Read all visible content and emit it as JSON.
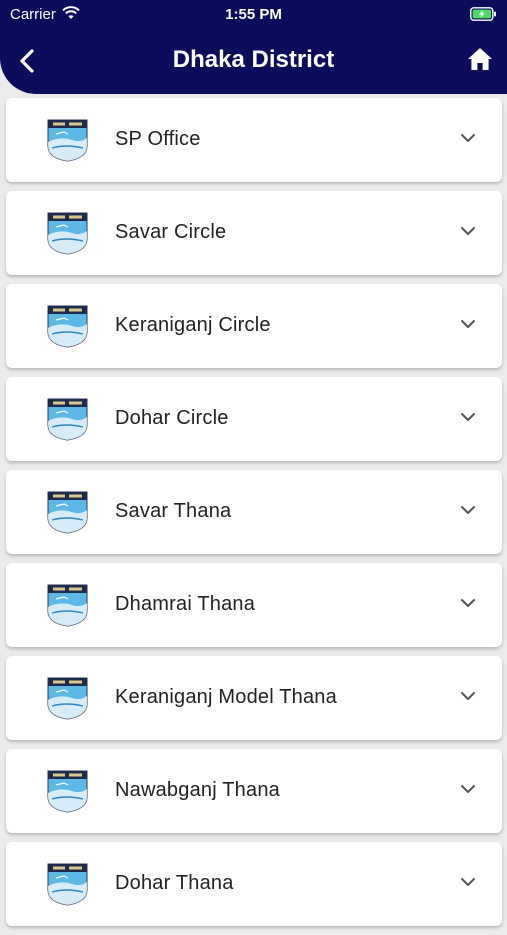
{
  "status_bar": {
    "carrier": "Carrier",
    "time": "1:55 PM",
    "icons": [
      "wifi-icon",
      "battery-charging-icon"
    ]
  },
  "header": {
    "title": "Dhaka District",
    "back_icon": "chevron-left-icon",
    "home_icon": "home-icon"
  },
  "colors": {
    "header_bg": "#0b0d5c",
    "page_bg": "#ebebeb",
    "card_bg": "#ffffff",
    "battery_fill": "#4cd964"
  },
  "list": {
    "items": [
      {
        "label": "SP Office"
      },
      {
        "label": "Savar Circle"
      },
      {
        "label": "Keraniganj Circle"
      },
      {
        "label": "Dohar Circle"
      },
      {
        "label": "Savar Thana"
      },
      {
        "label": "Dhamrai Thana"
      },
      {
        "label": "Keraniganj Model Thana"
      },
      {
        "label": "Nawabganj Thana"
      },
      {
        "label": "Dohar Thana"
      }
    ],
    "item_icon": "police-logo-icon",
    "expand_icon": "chevron-down-icon"
  }
}
